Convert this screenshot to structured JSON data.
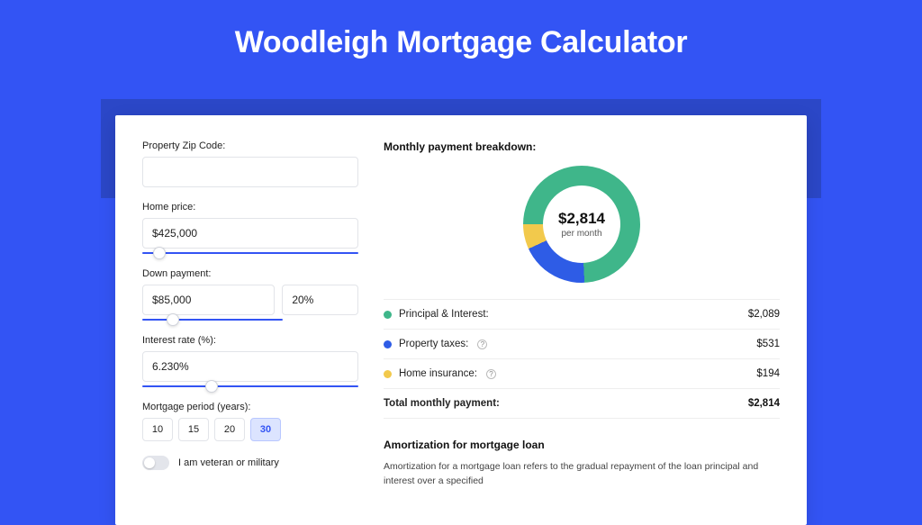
{
  "hero": {
    "title": "Woodleigh Mortgage Calculator"
  },
  "form": {
    "zip": {
      "label": "Property Zip Code:",
      "value": ""
    },
    "price": {
      "label": "Home price:",
      "value": "$425,000",
      "slider_pct": 8
    },
    "down": {
      "label": "Down payment:",
      "value": "$85,000",
      "pct_value": "20%",
      "slider_pct": 22
    },
    "rate": {
      "label": "Interest rate (%):",
      "value": "6.230%",
      "slider_pct": 32
    },
    "period": {
      "label": "Mortgage period (years):",
      "options": [
        "10",
        "15",
        "20",
        "30"
      ],
      "selected": "30"
    },
    "veteran": {
      "label": "I am veteran or military",
      "on": false
    }
  },
  "breakdown": {
    "title": "Monthly payment breakdown:",
    "center_amount": "$2,814",
    "center_sub": "per month",
    "items": [
      {
        "label": "Principal & Interest:",
        "value": "$2,089",
        "color": "#3FB68A",
        "info": false,
        "numeric": 2089
      },
      {
        "label": "Property taxes:",
        "value": "$531",
        "color": "#2E5CE6",
        "info": true,
        "numeric": 531
      },
      {
        "label": "Home insurance:",
        "value": "$194",
        "color": "#F2C94C",
        "info": true,
        "numeric": 194
      }
    ],
    "total": {
      "label": "Total monthly payment:",
      "value": "$2,814"
    }
  },
  "amort": {
    "title": "Amortization for mortgage loan",
    "text": "Amortization for a mortgage loan refers to the gradual repayment of the loan principal and interest over a specified"
  },
  "chart_data": {
    "type": "pie",
    "title": "Monthly payment breakdown",
    "series": [
      {
        "name": "Principal & Interest",
        "value": 2089,
        "color": "#3FB68A"
      },
      {
        "name": "Property taxes",
        "value": 531,
        "color": "#2E5CE6"
      },
      {
        "name": "Home insurance",
        "value": 194,
        "color": "#F2C94C"
      }
    ],
    "total": 2814,
    "center_label": "$2,814 per month"
  }
}
